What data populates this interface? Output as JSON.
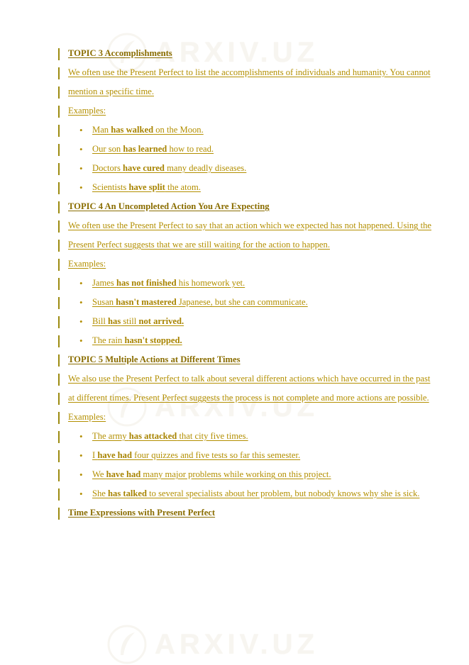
{
  "document": {
    "watermark_text": "ARXIV.UZ",
    "accent_color": "#b38f00",
    "heading_color": "#8a6d00",
    "changebar_color": "#9c8b10",
    "blocks": [
      {
        "type": "heading",
        "id": "topic3-heading",
        "text": "TOPIC 3 Accomplishments"
      },
      {
        "type": "paragraph",
        "id": "topic3-body",
        "text": "We often use the Present Perfect to list the accomplishments of individuals and humanity. You cannot mention a specific time."
      },
      {
        "type": "paragraph",
        "id": "topic3-examples-label",
        "text": "Examples:"
      },
      {
        "type": "bullets",
        "id": "topic3-examples",
        "items": [
          {
            "pre": "Man ",
            "bold": "has walked",
            "post": " on the Moon."
          },
          {
            "pre": "Our son ",
            "bold": "has learned",
            "post": " how to read."
          },
          {
            "pre": "Doctors ",
            "bold": "have cured",
            "post": " many deadly diseases."
          },
          {
            "pre": "Scientists ",
            "bold": "have split",
            "post": " the atom."
          }
        ]
      },
      {
        "type": "heading",
        "id": "topic4-heading",
        "text": "TOPIC 4 An Uncompleted Action You Are Expecting"
      },
      {
        "type": "paragraph",
        "id": "topic4-body",
        "text": "We often use the Present Perfect to say that an action which we expected has not happened. Using the Present Perfect suggests that we are still waiting for the action to happen."
      },
      {
        "type": "paragraph",
        "id": "topic4-examples-label",
        "text": "Examples:"
      },
      {
        "type": "bullets",
        "id": "topic4-examples",
        "items": [
          {
            "pre": "James ",
            "bold": "has not finished",
            "post": " his homework yet."
          },
          {
            "pre": "Susan ",
            "bold": "hasn't mastered",
            "post": " Japanese, but she can communicate."
          },
          {
            "pre": "Bill ",
            "bold": "has",
            "mid": " still ",
            "bold2": "not arrived.",
            "post": ""
          },
          {
            "pre": "The rain ",
            "bold": "hasn't stopped.",
            "post": ""
          }
        ]
      },
      {
        "type": "heading",
        "id": "topic5-heading",
        "text": "TOPIC 5 Multiple Actions at Different Times"
      },
      {
        "type": "paragraph",
        "id": "topic5-body",
        "text": "We also use the Present Perfect to talk about several different actions which have occurred in the past at different times. Present Perfect suggests the process is not complete and more actions are possible."
      },
      {
        "type": "paragraph",
        "id": "topic5-examples-label",
        "text": "Examples:"
      },
      {
        "type": "bullets",
        "id": "topic5-examples",
        "items": [
          {
            "pre": "The army ",
            "bold": "has attacked",
            "post": " that city five times."
          },
          {
            "pre": "I ",
            "bold": "have had",
            "post": " four quizzes and five tests so far this semester."
          },
          {
            "pre": "We ",
            "bold": "have had",
            "post": " many major problems while working on this project."
          },
          {
            "pre": "She ",
            "bold": "has talked",
            "post": " to several specialists about her problem, but nobody knows why she is sick."
          }
        ]
      },
      {
        "type": "heading",
        "id": "time-expressions-heading",
        "text": "Time Expressions with Present Perfect"
      }
    ]
  }
}
